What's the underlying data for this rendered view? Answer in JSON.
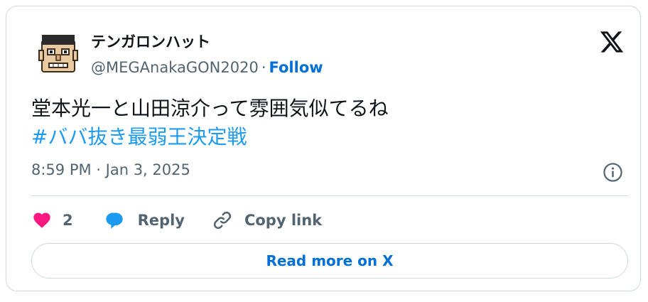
{
  "author": {
    "display_name": "テンガロンハット",
    "handle": "@MEGAnakaGON2020",
    "separator": "·",
    "follow_label": "Follow"
  },
  "tweet": {
    "text": "堂本光一と山田涼介って雰囲気似てるね",
    "hashtag": "#ババ抜き最弱王決定戦",
    "timestamp": "8:59 PM · Jan 3, 2025"
  },
  "actions": {
    "like_count": "2",
    "reply_label": "Reply",
    "copy_link_label": "Copy link"
  },
  "read_more_label": "Read more on X",
  "colors": {
    "link_blue": "#006fd6",
    "hashtag_blue": "#1d9bf0",
    "like_pink": "#f91880",
    "reply_blue": "#1d9bf0",
    "muted_gray": "#536471",
    "border": "#cfd9de"
  },
  "icons": [
    "avatar-image",
    "x-logo-icon",
    "info-icon",
    "heart-icon",
    "reply-bubble-icon",
    "link-icon"
  ]
}
